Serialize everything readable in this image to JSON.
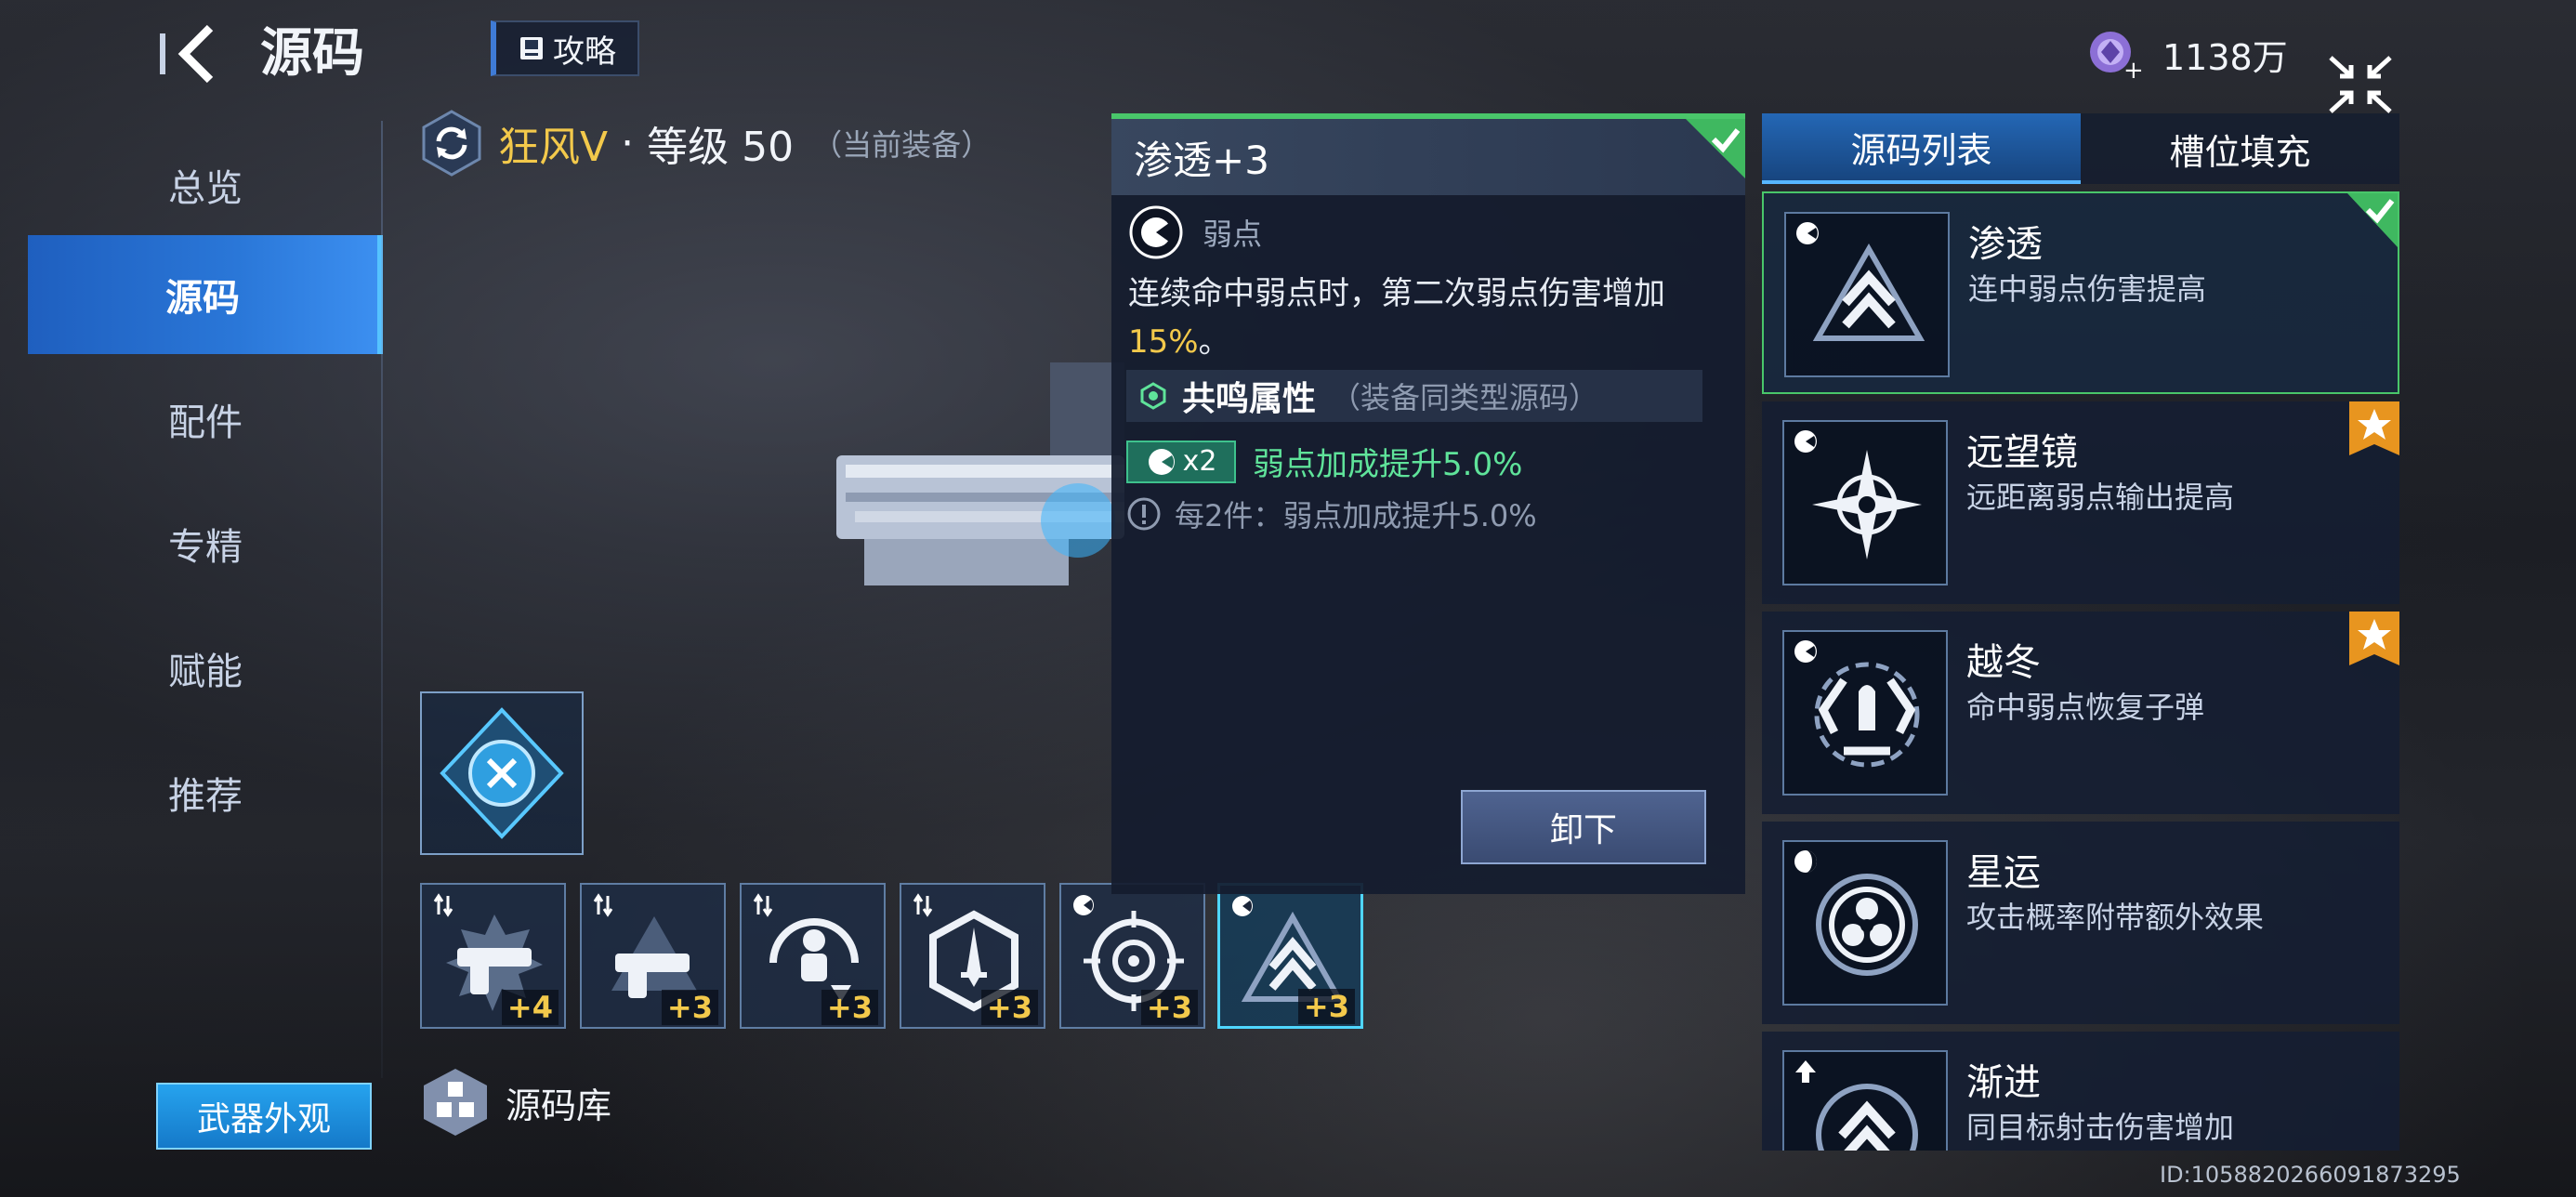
{
  "header": {
    "title": "源码",
    "guide_label": "攻略",
    "currency_value": "1138万"
  },
  "nav": {
    "items": [
      {
        "label": "总览",
        "active": false
      },
      {
        "label": "源码",
        "active": true
      },
      {
        "label": "配件",
        "active": false
      },
      {
        "label": "专精",
        "active": false
      },
      {
        "label": "赋能",
        "active": false
      },
      {
        "label": "推荐",
        "active": false
      }
    ],
    "skin_button": "武器外观"
  },
  "weapon": {
    "name": "狂风Ⅴ",
    "separator": "·",
    "level": "等级 50",
    "status": "（当前装备）"
  },
  "slots": [
    {
      "level": "+4",
      "icon": "revolver-spikes-icon"
    },
    {
      "level": "+3",
      "icon": "revolver-triangle-icon"
    },
    {
      "level": "+3",
      "icon": "figure-down-arrow-icon"
    },
    {
      "level": "+3",
      "icon": "hex-dagger-icon"
    },
    {
      "level": "+3",
      "icon": "crosshair-icon"
    },
    {
      "level": "+3",
      "icon": "chevron-triangle-icon",
      "active": true
    }
  ],
  "library": {
    "label": "源码库"
  },
  "detail": {
    "title": "渗透+3",
    "type_label": "弱点",
    "desc_main": "连续命中弱点时，第二次弱点伤害增加",
    "desc_highlight": "15%",
    "desc_end": "。",
    "resonance_title": "共鸣属性",
    "resonance_note": "（装备同类型源码）",
    "bonus_count": "x2",
    "bonus_text": "弱点加成提升5.0%",
    "bonus_every": "每2件：弱点加成提升5.0%",
    "unequip_label": "卸下"
  },
  "tabs": [
    {
      "label": "源码列表",
      "active": true
    },
    {
      "label": "槽位填充",
      "active": false
    }
  ],
  "list": [
    {
      "name": "渗透",
      "desc": "连中弱点伤害提高",
      "badge": "check",
      "icon": "chevron-triangle-icon"
    },
    {
      "name": "远望镜",
      "desc": "远距离弱点输出提高",
      "badge": "star",
      "icon": "compass-star-icon"
    },
    {
      "name": "越冬",
      "desc": "命中弱点恢复子弹",
      "badge": "star",
      "icon": "bullet-recycle-icon"
    },
    {
      "name": "星运",
      "desc": "攻击概率附带额外效果",
      "badge": "",
      "icon": "tri-circle-icon"
    },
    {
      "name": "渐进",
      "desc": "同目标射击伤害增加",
      "badge": "",
      "icon": "chevron-circle-icon"
    }
  ],
  "footer": {
    "id_text": "ID:1058820266091873295"
  },
  "colors": {
    "accent": "#2a77d8",
    "gold": "#f3c94b",
    "green": "#49c66a",
    "teal": "#4fd6ff"
  }
}
